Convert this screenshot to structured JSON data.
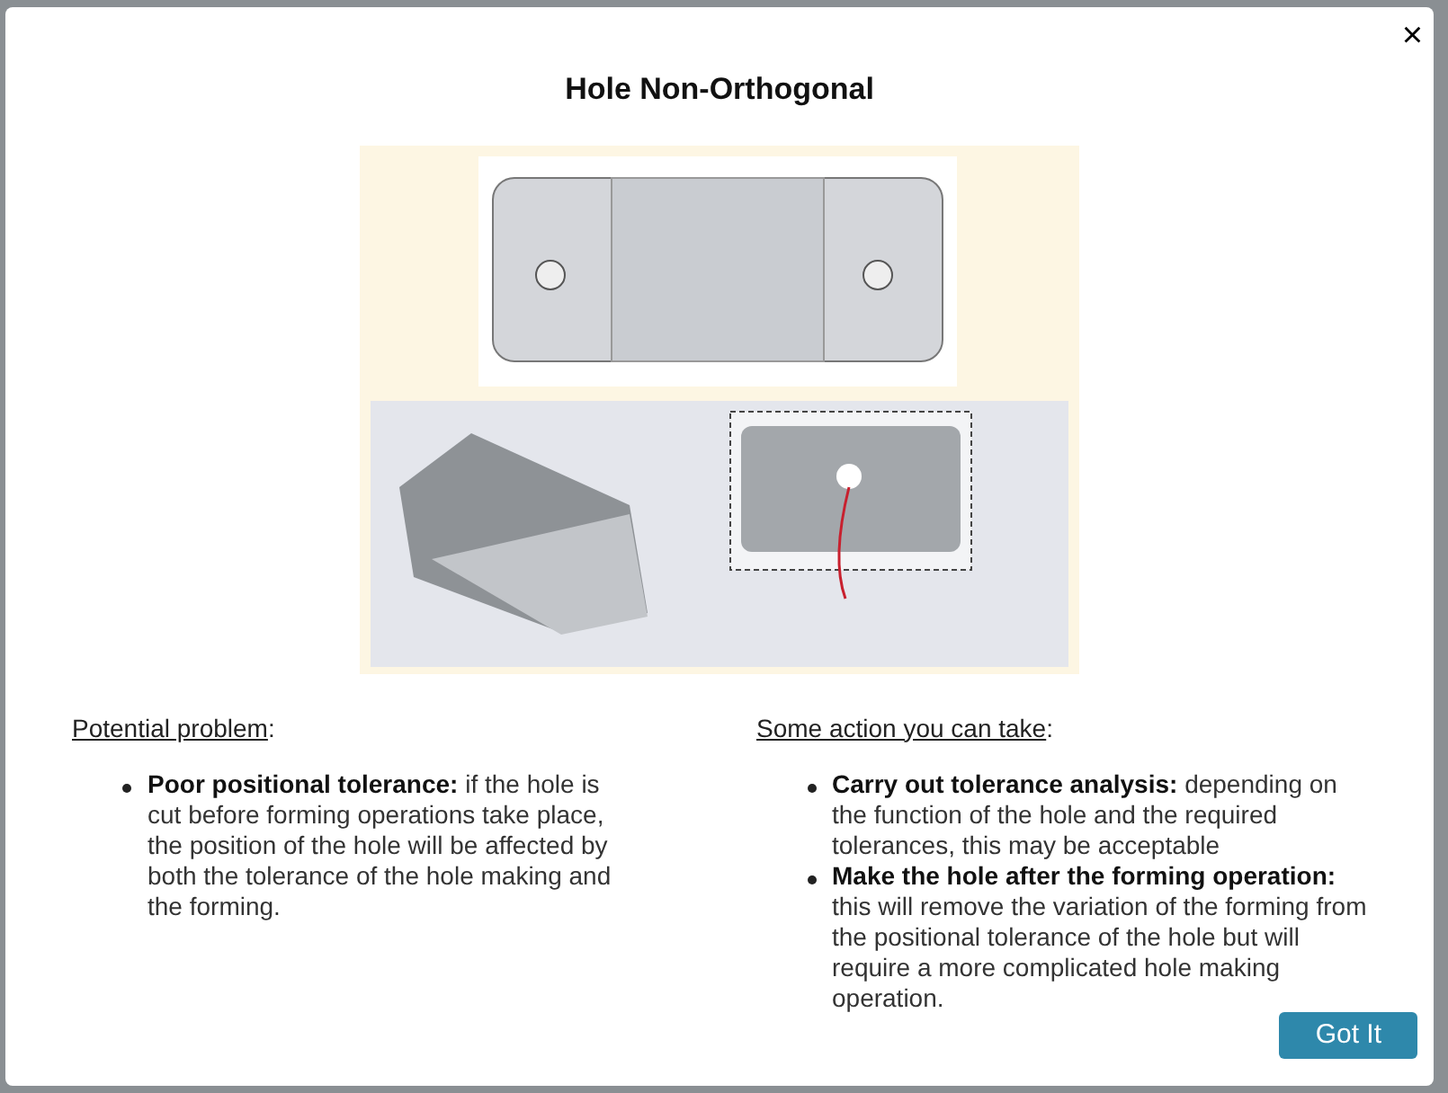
{
  "dialog": {
    "title": "Hole Non-Orthogonal",
    "close": "×",
    "columns": [
      {
        "heading": "Potential problem",
        "suffix": ":",
        "bullets": [
          "**Poor positional tolerance:** if the hole is cut before forming operations take place, the position of the hole will be affected by both the tolerance of the hole making and the forming."
        ]
      },
      {
        "heading": "Some action you can take",
        "suffix": ":",
        "bullets": [
          "**Carry out tolerance analysis:** depending on the function of the hole and the required tolerances, this may be acceptable",
          "**Make the hole after the forming operation:** this will remove the variation of the forming from the positional tolerance of the hole but will require a more complicated hole making operation."
        ]
      }
    ],
    "button": "Got It"
  }
}
